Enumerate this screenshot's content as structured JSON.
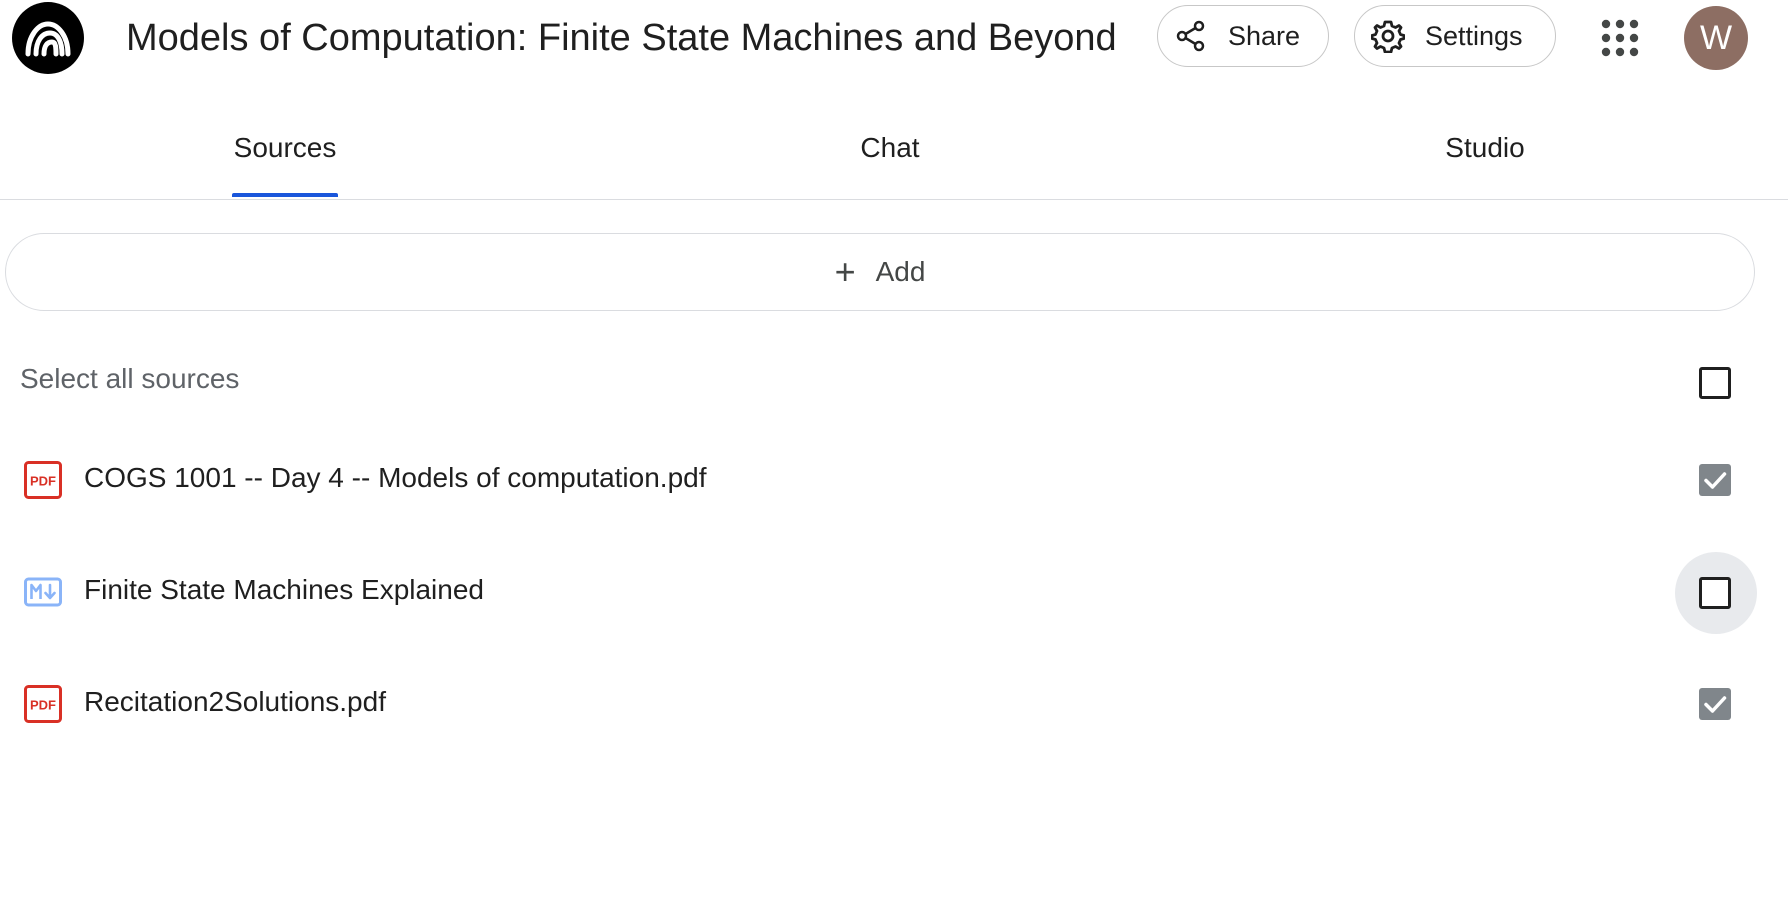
{
  "header": {
    "title": "Models of Computation: Finite State Machines and Beyond",
    "share_label": "Share",
    "settings_label": "Settings",
    "avatar_initial": "W"
  },
  "tabs": [
    {
      "label": "Sources",
      "active": true
    },
    {
      "label": "Chat",
      "active": false
    },
    {
      "label": "Studio",
      "active": false
    }
  ],
  "sources_panel": {
    "add_label": "Add",
    "select_all_label": "Select all sources",
    "select_all_checked": false,
    "items": [
      {
        "type": "pdf",
        "icon": "pdf-icon",
        "label": "COGS 1001 -- Day 4 -- Models of computation.pdf",
        "checked": true
      },
      {
        "type": "markdown",
        "icon": "markdown-icon",
        "label": "Finite State Machines Explained",
        "checked": false
      },
      {
        "type": "pdf",
        "icon": "pdf-icon",
        "label": "Recitation2Solutions.pdf",
        "checked": true
      }
    ]
  },
  "colors": {
    "accent": "#1a56db",
    "pdf_red": "#d93025",
    "markdown_blue": "#8ab4f8",
    "checked_gray": "#80868b",
    "avatar_bg": "#8d6e63"
  }
}
